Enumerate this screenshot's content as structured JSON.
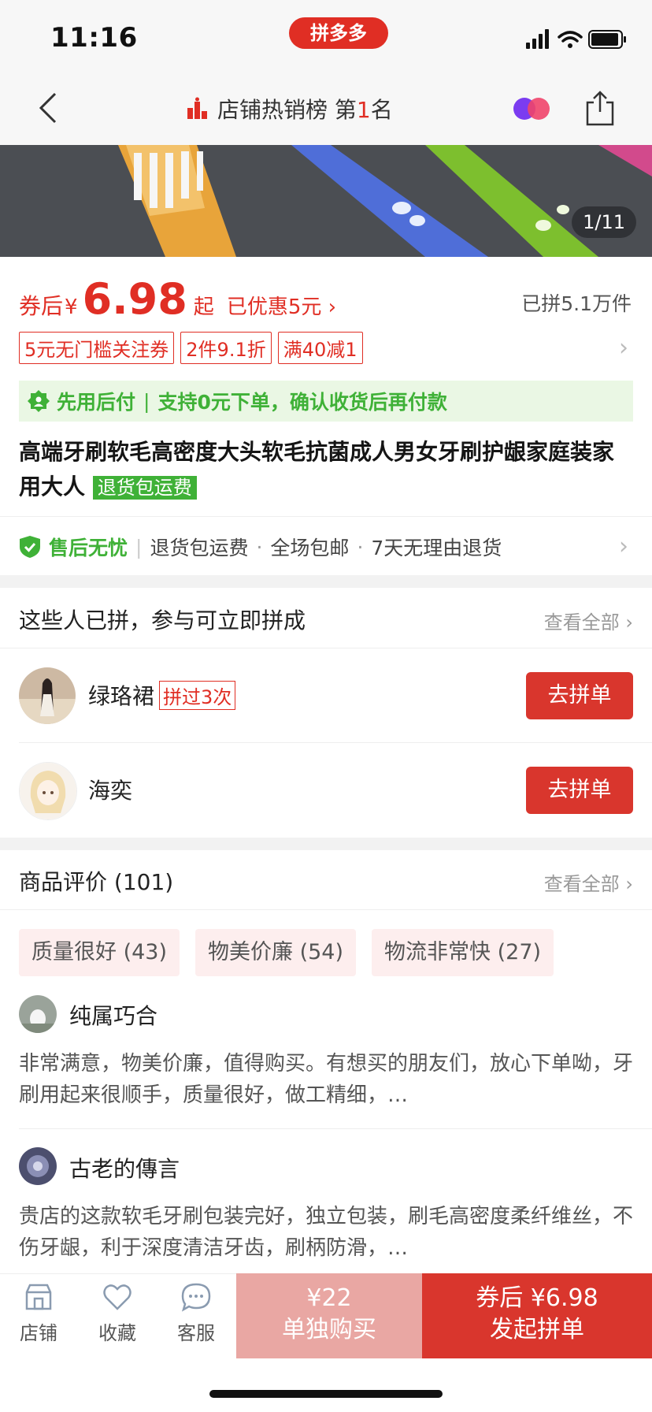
{
  "status": {
    "time": "11:16",
    "app_logo": "拼多多"
  },
  "nav": {
    "rank_label": "店铺热销榜 第",
    "rank_num": "1",
    "rank_suffix": "名"
  },
  "banner": {
    "pager": "1/11"
  },
  "price": {
    "label": "券后",
    "yen": "¥",
    "value": "6.98",
    "qi": "起",
    "discount": "已优惠5元",
    "sold": "已拼5.1万件"
  },
  "coupons": [
    "5元无门槛关注券",
    "2件9.1折",
    "满40减1"
  ],
  "paylater": {
    "title": "先用后付",
    "desc": "支持0元下单，确认收货后再付款"
  },
  "product": {
    "title": "高端牙刷软毛高密度大头软毛抗菌成人男女牙刷护龈家庭装家用大人",
    "tag": "退货包运费"
  },
  "after_sale": {
    "title": "售后无忧",
    "items": [
      "退货包运费",
      "全场包邮",
      "7天无理由退货"
    ]
  },
  "group": {
    "title": "这些人已拼，参与可立即拼成",
    "view_all": "查看全部",
    "users": [
      {
        "name": "绿珞裙",
        "badge": "拼过3次",
        "button": "去拼单"
      },
      {
        "name": "海奕",
        "badge": "",
        "button": "去拼单"
      }
    ]
  },
  "reviews": {
    "title": "商品评价 (101)",
    "view_all": "查看全部",
    "tags": [
      "质量很好 (43)",
      "物美价廉 (54)",
      "物流非常快 (27)"
    ],
    "items": [
      {
        "name": "纯属巧合",
        "text": "非常满意，物美价廉，值得购买。有想买的朋友们，放心下单呦，牙刷用起来很顺手，质量很好，做工精细，…"
      },
      {
        "name": "古老的傳言",
        "text": "贵店的这款软毛牙刷包装完好，独立包装，刷毛高密度柔纤维丝，不伤牙龈，利于深度清洁牙齿，刷柄防滑，…"
      }
    ]
  },
  "bottom": {
    "store": "店铺",
    "favorite": "收藏",
    "service": "客服",
    "single_price": "¥22",
    "single_label": "单独购买",
    "group_price": "券后 ¥6.98",
    "group_label": "发起拼单"
  },
  "colors": {
    "brand": "#e02e24",
    "green": "#3fb137"
  }
}
